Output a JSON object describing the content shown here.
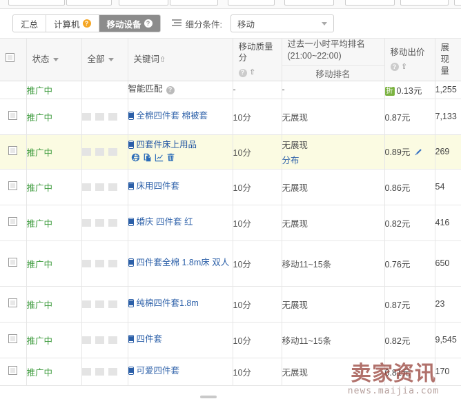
{
  "tabs": [
    {
      "label": "汇总",
      "help": false,
      "active": false
    },
    {
      "label": "计算机",
      "help": true,
      "help_style": "orange",
      "active": false
    },
    {
      "label": "移动设备",
      "help": true,
      "help_style": "white",
      "active": true
    }
  ],
  "filter": {
    "icon": "list-lines-icon",
    "label": "细分条件:",
    "value": "移动",
    "caret": "chevron-down-icon"
  },
  "table": {
    "headers": {
      "check": "",
      "state": "状态",
      "all": "全部",
      "keyword": "关键词",
      "quality": "移动质量分",
      "rank": "过去一小时平均排名(21:00~22:00)",
      "rank_sub": "移动排名",
      "bid": "移动出价",
      "impressions": "展现量"
    },
    "rows": [
      {
        "checkbox": false,
        "state": "推广中",
        "blocks": 0,
        "keyword": "智能匹配",
        "keyword_help": true,
        "has_phone_icon": false,
        "has_row_icons": false,
        "quality": "-",
        "rank": "-",
        "rank_sub": "",
        "bid_badge": "折",
        "bid": "0.13元",
        "has_pencil": false,
        "impressions": "1,255"
      },
      {
        "checkbox": true,
        "state": "推广中",
        "blocks": 3,
        "keyword": "全棉四件套 棉被套",
        "keyword_help": false,
        "has_phone_icon": true,
        "has_row_icons": false,
        "quality": "10分",
        "rank": "无展现",
        "rank_sub": "",
        "bid_badge": "",
        "bid": "0.87元",
        "has_pencil": false,
        "impressions": "7,133"
      },
      {
        "checkbox": true,
        "state": "推广中",
        "blocks": 3,
        "keyword": "四套件床上用品",
        "keyword_help": false,
        "has_phone_icon": true,
        "has_row_icons": true,
        "row_icons": [
          "globe-icon",
          "copy-icon",
          "trend-chart-icon",
          "trash-icon"
        ],
        "quality": "10分",
        "rank": "无展现",
        "rank_sub": "分布",
        "bid_badge": "",
        "bid": "0.89元",
        "has_pencil": true,
        "impressions": "269",
        "highlighted": true
      },
      {
        "checkbox": true,
        "state": "推广中",
        "blocks": 3,
        "keyword": "床用四件套",
        "keyword_help": false,
        "has_phone_icon": true,
        "has_row_icons": false,
        "quality": "10分",
        "rank": "无展现",
        "rank_sub": "",
        "bid_badge": "",
        "bid": "0.86元",
        "has_pencil": false,
        "impressions": "54"
      },
      {
        "checkbox": true,
        "state": "推广中",
        "blocks": 3,
        "keyword": "婚庆 四件套 红",
        "keyword_help": false,
        "has_phone_icon": true,
        "has_row_icons": false,
        "quality": "10分",
        "rank": "无展现",
        "rank_sub": "",
        "bid_badge": "",
        "bid": "0.82元",
        "has_pencil": false,
        "impressions": "416"
      },
      {
        "checkbox": true,
        "state": "推广中",
        "blocks": 3,
        "keyword": "四件套全棉 1.8m床 双人",
        "keyword_help": false,
        "has_phone_icon": true,
        "has_row_icons": false,
        "quality": "10分",
        "rank": "移动11~15条",
        "rank_sub": "",
        "bid_badge": "",
        "bid": "0.76元",
        "has_pencil": false,
        "impressions": "650"
      },
      {
        "checkbox": true,
        "state": "推广中",
        "blocks": 3,
        "keyword": "纯棉四件套1.8m",
        "keyword_help": false,
        "has_phone_icon": true,
        "has_row_icons": false,
        "quality": "10分",
        "rank": "无展现",
        "rank_sub": "",
        "bid_badge": "",
        "bid": "0.87元",
        "has_pencil": false,
        "impressions": "23"
      },
      {
        "checkbox": true,
        "state": "推广中",
        "blocks": 3,
        "keyword": "四件套",
        "keyword_help": false,
        "has_phone_icon": true,
        "has_row_icons": false,
        "quality": "10分",
        "rank": "移动11~15条",
        "rank_sub": "",
        "bid_badge": "",
        "bid": "0.82元",
        "has_pencil": false,
        "impressions": "9,545"
      },
      {
        "checkbox": true,
        "state": "推广中",
        "blocks": 3,
        "keyword": "可爱四件套",
        "keyword_help": false,
        "has_phone_icon": true,
        "has_row_icons": false,
        "quality": "10分",
        "rank": "无展现",
        "rank_sub": "",
        "bid_badge": "",
        "bid": "0.81元",
        "has_pencil": false,
        "impressions": "170"
      }
    ]
  },
  "watermark": {
    "cn": "卖家资讯",
    "en": "news.maijia.com"
  },
  "colors": {
    "state_green": "#3d9b3d",
    "link_blue": "#2b5fa8",
    "highlight_row": "#fbfbe2",
    "active_tab": "#8c8c8c",
    "badge_green": "#7cb342"
  }
}
